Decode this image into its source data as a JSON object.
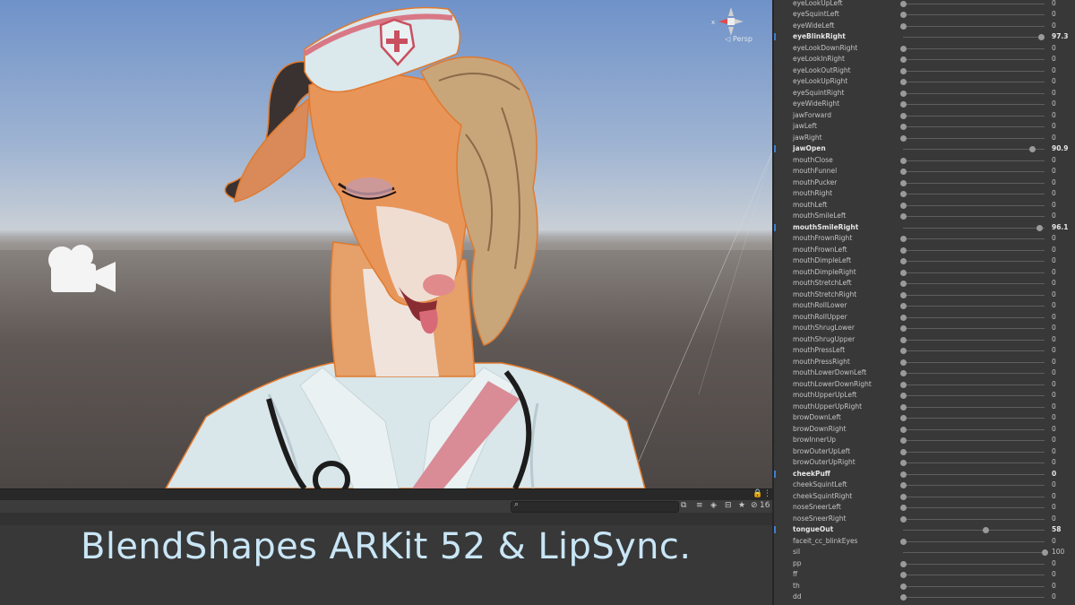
{
  "scene": {
    "gizmo_label": "◁ Persp",
    "gizmo_axis_x": "x",
    "camera_icon": "video-camera-icon"
  },
  "toolbar": {
    "search_icon": "search-icon",
    "layers_count": "16"
  },
  "caption": "BlendShapes ARKit 52 & LipSync.",
  "colors": {
    "caption_text": "#c9e6f6",
    "active_marker": "#3e7fd0",
    "panel_bg": "#383838"
  },
  "blendshapes": [
    {
      "name": "eyeLookUpLeft",
      "value": "0",
      "fraction": 0,
      "active": false
    },
    {
      "name": "eyeSquintLeft",
      "value": "0",
      "fraction": 0,
      "active": false
    },
    {
      "name": "eyeWideLeft",
      "value": "0",
      "fraction": 0,
      "active": false
    },
    {
      "name": "eyeBlinkRight",
      "value": "97.3",
      "fraction": 0.973,
      "active": true
    },
    {
      "name": "eyeLookDownRight",
      "value": "0",
      "fraction": 0,
      "active": false
    },
    {
      "name": "eyeLookInRight",
      "value": "0",
      "fraction": 0,
      "active": false
    },
    {
      "name": "eyeLookOutRight",
      "value": "0",
      "fraction": 0,
      "active": false
    },
    {
      "name": "eyeLookUpRight",
      "value": "0",
      "fraction": 0,
      "active": false
    },
    {
      "name": "eyeSquintRight",
      "value": "0",
      "fraction": 0,
      "active": false
    },
    {
      "name": "eyeWideRight",
      "value": "0",
      "fraction": 0,
      "active": false
    },
    {
      "name": "jawForward",
      "value": "0",
      "fraction": 0,
      "active": false
    },
    {
      "name": "jawLeft",
      "value": "0",
      "fraction": 0,
      "active": false
    },
    {
      "name": "jawRight",
      "value": "0",
      "fraction": 0,
      "active": false
    },
    {
      "name": "jawOpen",
      "value": "90.9",
      "fraction": 0.909,
      "active": true
    },
    {
      "name": "mouthClose",
      "value": "0",
      "fraction": 0,
      "active": false
    },
    {
      "name": "mouthFunnel",
      "value": "0",
      "fraction": 0,
      "active": false
    },
    {
      "name": "mouthPucker",
      "value": "0",
      "fraction": 0,
      "active": false
    },
    {
      "name": "mouthRight",
      "value": "0",
      "fraction": 0,
      "active": false
    },
    {
      "name": "mouthLeft",
      "value": "0",
      "fraction": 0,
      "active": false
    },
    {
      "name": "mouthSmileLeft",
      "value": "0",
      "fraction": 0,
      "active": false
    },
    {
      "name": "mouthSmileRight",
      "value": "96.1",
      "fraction": 0.961,
      "active": true
    },
    {
      "name": "mouthFrownRight",
      "value": "0",
      "fraction": 0,
      "active": false
    },
    {
      "name": "mouthFrownLeft",
      "value": "0",
      "fraction": 0,
      "active": false
    },
    {
      "name": "mouthDimpleLeft",
      "value": "0",
      "fraction": 0,
      "active": false
    },
    {
      "name": "mouthDimpleRight",
      "value": "0",
      "fraction": 0,
      "active": false
    },
    {
      "name": "mouthStretchLeft",
      "value": "0",
      "fraction": 0,
      "active": false
    },
    {
      "name": "mouthStretchRight",
      "value": "0",
      "fraction": 0,
      "active": false
    },
    {
      "name": "mouthRollLower",
      "value": "0",
      "fraction": 0,
      "active": false
    },
    {
      "name": "mouthRollUpper",
      "value": "0",
      "fraction": 0,
      "active": false
    },
    {
      "name": "mouthShrugLower",
      "value": "0",
      "fraction": 0,
      "active": false
    },
    {
      "name": "mouthShrugUpper",
      "value": "0",
      "fraction": 0,
      "active": false
    },
    {
      "name": "mouthPressLeft",
      "value": "0",
      "fraction": 0,
      "active": false
    },
    {
      "name": "mouthPressRight",
      "value": "0",
      "fraction": 0,
      "active": false
    },
    {
      "name": "mouthLowerDownLeft",
      "value": "0",
      "fraction": 0,
      "active": false
    },
    {
      "name": "mouthLowerDownRight",
      "value": "0",
      "fraction": 0,
      "active": false
    },
    {
      "name": "mouthUpperUpLeft",
      "value": "0",
      "fraction": 0,
      "active": false
    },
    {
      "name": "mouthUpperUpRight",
      "value": "0",
      "fraction": 0,
      "active": false
    },
    {
      "name": "browDownLeft",
      "value": "0",
      "fraction": 0,
      "active": false
    },
    {
      "name": "browDownRight",
      "value": "0",
      "fraction": 0,
      "active": false
    },
    {
      "name": "browInnerUp",
      "value": "0",
      "fraction": 0,
      "active": false
    },
    {
      "name": "browOuterUpLeft",
      "value": "0",
      "fraction": 0,
      "active": false
    },
    {
      "name": "browOuterUpRight",
      "value": "0",
      "fraction": 0,
      "active": false
    },
    {
      "name": "cheekPuff",
      "value": "0",
      "fraction": 0,
      "active": true
    },
    {
      "name": "cheekSquintLeft",
      "value": "0",
      "fraction": 0,
      "active": false
    },
    {
      "name": "cheekSquintRight",
      "value": "0",
      "fraction": 0,
      "active": false
    },
    {
      "name": "noseSneerLeft",
      "value": "0",
      "fraction": 0,
      "active": false
    },
    {
      "name": "noseSneerRight",
      "value": "0",
      "fraction": 0,
      "active": false
    },
    {
      "name": "tongueOut",
      "value": "58",
      "fraction": 0.58,
      "active": true
    },
    {
      "name": "faceit_cc_blinkEyes",
      "value": "0",
      "fraction": 0,
      "active": false
    },
    {
      "name": "sil",
      "value": "100",
      "fraction": 1.0,
      "active": false
    },
    {
      "name": "pp",
      "value": "0",
      "fraction": 0,
      "active": false
    },
    {
      "name": "ff",
      "value": "0",
      "fraction": 0,
      "active": false
    },
    {
      "name": "th",
      "value": "0",
      "fraction": 0,
      "active": false
    },
    {
      "name": "dd",
      "value": "0",
      "fraction": 0,
      "active": false
    }
  ]
}
